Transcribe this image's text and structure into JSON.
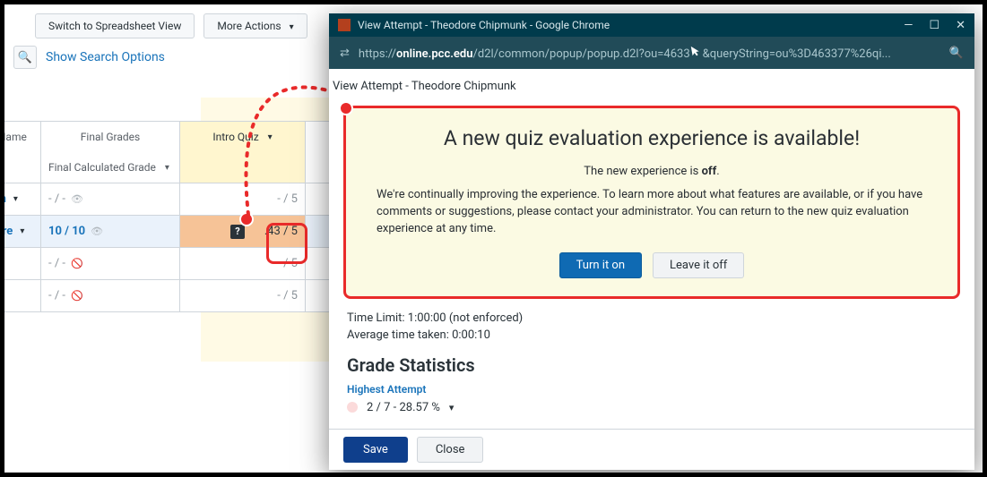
{
  "toolbar": {
    "switch_view": "Switch to Spreadsheet View",
    "more_actions": "More Actions",
    "search_options": "Show Search Options"
  },
  "grid": {
    "headers": {
      "first_name": "First Name",
      "final_grades": "Final Grades",
      "final_calc": "Final Calculated Grade",
      "intro_quiz": "Intro Quiz"
    },
    "rows": [
      {
        "name": "mon",
        "final": "- / -",
        "quiz": "- / 5"
      },
      {
        "name": "eodore",
        "final": "10 / 10",
        "quiz": ".43 / 5"
      },
      {
        "name": "",
        "final": "- / -",
        "quiz": "- / 5"
      },
      {
        "name": "",
        "final": "- / -",
        "quiz": "- / 5"
      }
    ]
  },
  "popup": {
    "window_title": "View Attempt - Theodore Chipmunk - Google Chrome",
    "url_pre": "https://",
    "url_host": "online.pcc.edu",
    "url_rest": "/d2l/common/popup/popup.d2l?ou=4633",
    "url_tail": "&queryString=ou%3D463377%26qi...",
    "crumb": "View Attempt - Theodore Chipmunk",
    "banner": {
      "title": "A new quiz evaluation experience is available!",
      "status_pre": "The new experience is ",
      "status_bold": "off",
      "status_post": ".",
      "body": "We're continually improving the experience. To learn more about what features are available, or if you have comments or suggestions, please contact your administrator. You can return to the new quiz evaluation experience at any time.",
      "turn_on": "Turn it on",
      "leave_off": "Leave it off"
    },
    "time_limit": "Time Limit: 1:00:00 (not enforced)",
    "avg_time": "Average time taken: 0:00:10",
    "stats_title": "Grade Statistics",
    "highest_attempt_label": "Highest Attempt",
    "highest_attempt_value": "2 / 7 - 28.57 %",
    "save": "Save",
    "close": "Close"
  }
}
